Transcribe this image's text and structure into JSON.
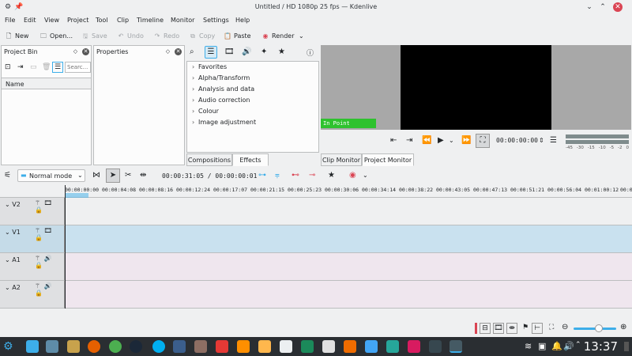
{
  "window": {
    "title": "Untitled / HD 1080p 25 fps — Kdenlive"
  },
  "menu": [
    "File",
    "Edit",
    "View",
    "Project",
    "Tool",
    "Clip",
    "Timeline",
    "Monitor",
    "Settings",
    "Help"
  ],
  "toolbar": {
    "new": "New",
    "open": "Open...",
    "save": "Save",
    "undo": "Undo",
    "redo": "Redo",
    "copy": "Copy",
    "paste": "Paste",
    "render": "Render"
  },
  "project_bin": {
    "title": "Project Bin",
    "search_placeholder": "Searc...",
    "column_name": "Name"
  },
  "properties": {
    "title": "Properties"
  },
  "effects": {
    "items": [
      "Favorites",
      "Alpha/Transform",
      "Analysis and data",
      "Audio correction",
      "Colour",
      "Image adjustment"
    ],
    "tab_compositions": "Compositions",
    "tab_effects": "Effects"
  },
  "monitor": {
    "in_point": "In Point",
    "timecode": "00:00:00:00",
    "tab_clip": "Clip Monitor",
    "tab_project": "Project Monitor",
    "audio_scale": [
      "-45",
      "-30",
      "-15",
      "-10",
      "-5",
      "-2",
      "0"
    ]
  },
  "timeline": {
    "mode": "Normal mode",
    "timecode": "00:00:31:05 / 00:00:00:01",
    "ruler": [
      "00:00:00:00",
      "00:00:04:08",
      "00:00:08:16",
      "00:00:12:24",
      "00:00:17:07",
      "00:00:21:15",
      "00:00:25:23",
      "00:00:30:06",
      "00:00:34:14",
      "00:00:38:22",
      "00:00:43:05",
      "00:00:47:13",
      "00:00:51:21",
      "00:00:56:04",
      "00:01:00:12",
      "00:01"
    ],
    "tracks": [
      {
        "name": "V2",
        "type": "video",
        "color": "#eff0f1"
      },
      {
        "name": "V1",
        "type": "video",
        "color": "#c9e1ef"
      },
      {
        "name": "A1",
        "type": "audio",
        "color": "#efe6ee"
      },
      {
        "name": "A2",
        "type": "audio",
        "color": "#efe6ee"
      }
    ]
  },
  "taskbar": {
    "clock": "13:37"
  }
}
